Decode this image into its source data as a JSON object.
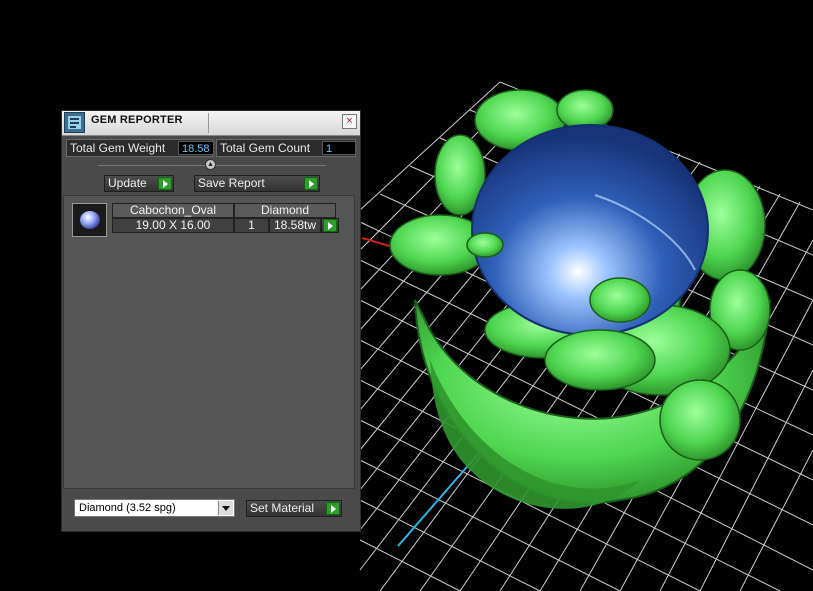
{
  "window": {
    "title": "GEM REPORTER",
    "close_label": "×"
  },
  "stats": {
    "total_weight_label": "Total Gem Weight",
    "total_weight_value": "18.58",
    "total_count_label": "Total Gem Count",
    "total_count_value": "1"
  },
  "buttons": {
    "update": "Update",
    "save_report": "Save Report",
    "set_material": "Set Material"
  },
  "gem_list": {
    "rows": [
      {
        "shape": "Cabochon_Oval",
        "material": "Diamond",
        "size": "19.00 X 16.00",
        "count": "1",
        "weight": "18.58tw"
      }
    ]
  },
  "material_select": {
    "selected": "Diamond     (3.52 spg)"
  },
  "colors": {
    "accent_value": "#62c6ff",
    "go_button": "#2f9c2f",
    "ring_green": "#5fe65f",
    "gem_blue": "#2f5fb8"
  },
  "icons": {
    "app": "gem-reporter-icon",
    "close": "close-icon",
    "go": "play-arrow-icon",
    "dropdown": "chevron-down-icon",
    "gem_thumb": "oval-cabochon-icon"
  }
}
